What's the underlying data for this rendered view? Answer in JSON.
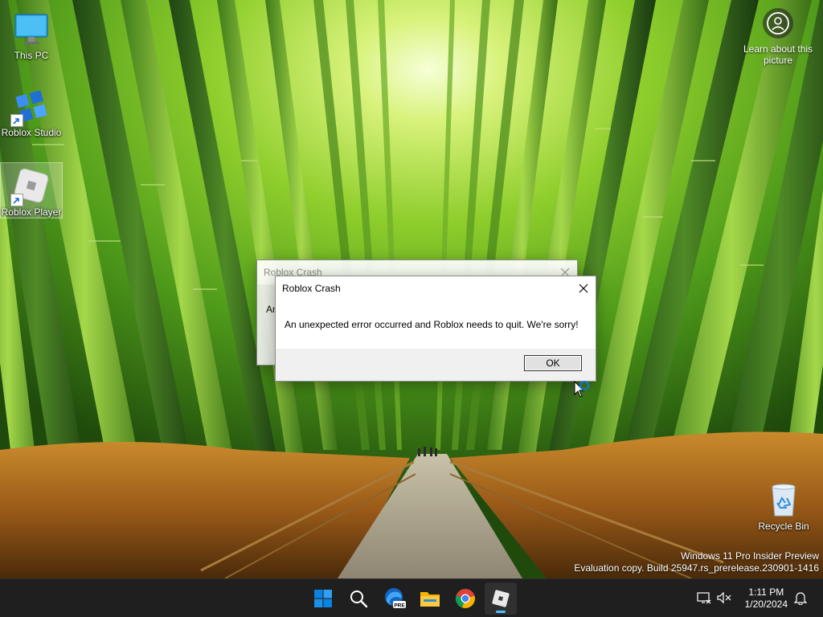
{
  "desktop": {
    "icons": [
      {
        "label": "This PC",
        "icon": "monitor-icon"
      },
      {
        "label": "Roblox Studio",
        "icon": "roblox-studio-icon"
      },
      {
        "label": "Roblox Player",
        "icon": "roblox-player-icon"
      },
      {
        "label": "Recycle Bin",
        "icon": "recycle-bin-icon"
      }
    ],
    "learn_about": "Learn about this picture",
    "watermark": {
      "line1": "Windows 11 Pro Insider Preview",
      "line2": "Evaluation copy. Build 25947.rs_prerelease.230901-1416"
    }
  },
  "back_dialog": {
    "title": "Roblox Crash",
    "text_fragment": "An"
  },
  "dialog": {
    "title": "Roblox Crash",
    "message": "An unexpected error occurred and Roblox needs to quit.  We're sorry!",
    "ok_label": "OK",
    "close_icon": "close-icon"
  },
  "taskbar": {
    "apps": [
      "windows-start-icon",
      "search-icon",
      "edge-beta-icon",
      "file-explorer-icon",
      "chrome-icon",
      "roblox-icon"
    ],
    "edge_badge": "PRE",
    "clock": {
      "time": "1:11 PM",
      "date": "1/20/2024"
    },
    "tray": [
      "network-icon",
      "volume-muted-icon",
      "notification-bell-icon"
    ]
  },
  "colors": {
    "accent": "#0078d4",
    "taskbar_bg": "#1f1f1f",
    "dialog_bg": "#f0f0f0",
    "indicator": "#4cc2ff"
  }
}
